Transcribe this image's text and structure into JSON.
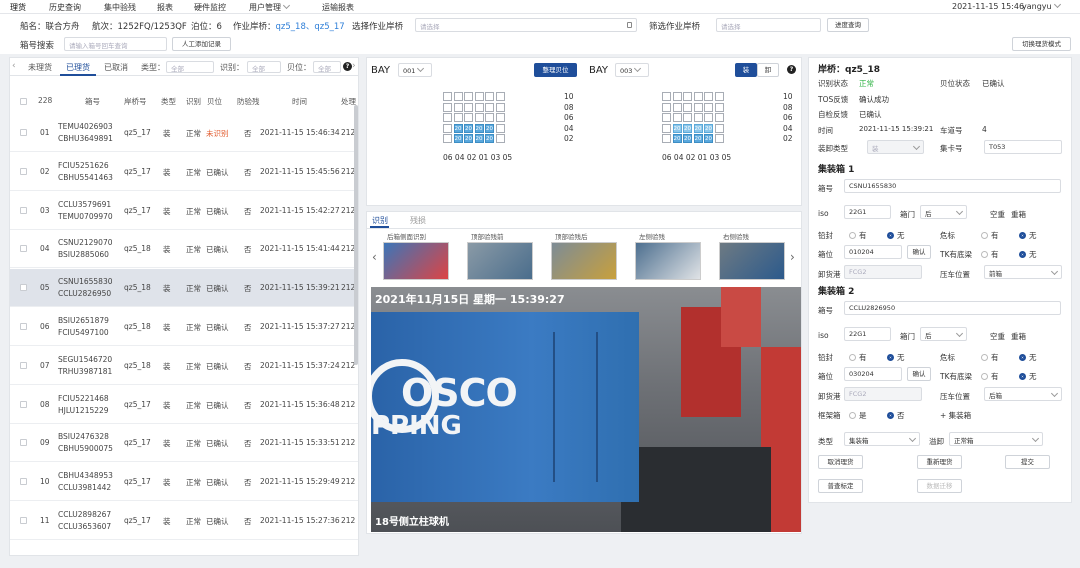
{
  "nav": {
    "items": [
      "理货",
      "历史查询",
      "集中验残",
      "报表",
      "硬件监控",
      "用户管理",
      "运输报表"
    ],
    "datetime": "2021-11-15 15:46",
    "user": "yangyu"
  },
  "info": {
    "ship_label": "船名：",
    "ship": "联合方舟",
    "voyage_label": "航次：",
    "voyage": "1252FQ/1253QF",
    "berth_label": "泊位：",
    "berth": "6",
    "bridge_label": "作业岸桥：",
    "bridge1": "qz5_18、",
    "bridge2": "qz5_17",
    "select_bridge_label": "选择作业岸桥",
    "select_placeholder": "请选择",
    "filter_label": "筛选作业岸桥",
    "filter_placeholder": "请选择",
    "progress_btn": "进度查询",
    "box_search_label": "箱号搜索",
    "box_search_placeholder": "请输入箱号回车查询",
    "manual_add": "人工添加记录",
    "switch_mode": "切换理货模式"
  },
  "left": {
    "tabs": [
      "未理货",
      "已理货",
      "已取消"
    ],
    "type_label": "类型：",
    "type_val": "全部",
    "ident_label": "识别：",
    "ident_val": "全部",
    "slot_label": "贝位：",
    "slot_val": "全部",
    "head": {
      "count": "228",
      "box": "箱号",
      "bridge": "岸桥号",
      "kind": "类型",
      "ident": "识别",
      "slot": "贝位",
      "inspect": "防验残",
      "time": "时间",
      "proc": "处理"
    },
    "rows": [
      {
        "no": "01",
        "b1": "TEMU4026903",
        "b2": "CBHU3649891",
        "bridge": "qz5_17",
        "kind": "装",
        "ident": "正常",
        "slot": "未识别",
        "inspect": "否",
        "time": "2021-11-15 15:46:34",
        "proc": "212"
      },
      {
        "no": "02",
        "b1": "FCIU5251626",
        "b2": "CBHU5541463",
        "bridge": "qz5_17",
        "kind": "装",
        "ident": "正常",
        "slot": "已确认",
        "inspect": "否",
        "time": "2021-11-15 15:45:56",
        "proc": "212"
      },
      {
        "no": "03",
        "b1": "CCLU3579691",
        "b2": "TEMU0709970",
        "bridge": "qz5_17",
        "kind": "装",
        "ident": "正常",
        "slot": "已确认",
        "inspect": "否",
        "time": "2021-11-15 15:42:27",
        "proc": "212"
      },
      {
        "no": "04",
        "b1": "CSNU2129070",
        "b2": "BSIU2885060",
        "bridge": "qz5_18",
        "kind": "装",
        "ident": "正常",
        "slot": "已确认",
        "inspect": "否",
        "time": "2021-11-15 15:41:44",
        "proc": "212"
      },
      {
        "no": "05",
        "b1": "CSNU1655830",
        "b2": "CCLU2826950",
        "bridge": "qz5_18",
        "kind": "装",
        "ident": "正常",
        "slot": "已确认",
        "inspect": "否",
        "time": "2021-11-15 15:39:21",
        "proc": "212"
      },
      {
        "no": "06",
        "b1": "BSIU2651879",
        "b2": "FCIU5497100",
        "bridge": "qz5_18",
        "kind": "装",
        "ident": "正常",
        "slot": "已确认",
        "inspect": "否",
        "time": "2021-11-15 15:37:27",
        "proc": "212"
      },
      {
        "no": "07",
        "b1": "SEGU1546720",
        "b2": "TRHU3987181",
        "bridge": "qz5_18",
        "kind": "装",
        "ident": "正常",
        "slot": "已确认",
        "inspect": "否",
        "time": "2021-11-15 15:37:24",
        "proc": "212"
      },
      {
        "no": "08",
        "b1": "FCIU5221468",
        "b2": "HJLU1215229",
        "bridge": "qz5_17",
        "kind": "装",
        "ident": "正常",
        "slot": "已确认",
        "inspect": "否",
        "time": "2021-11-15 15:36:48",
        "proc": "212"
      },
      {
        "no": "09",
        "b1": "BSIU2476328",
        "b2": "CBHU5900075",
        "bridge": "qz5_17",
        "kind": "装",
        "ident": "正常",
        "slot": "已确认",
        "inspect": "否",
        "time": "2021-11-15 15:33:51",
        "proc": "212"
      },
      {
        "no": "10",
        "b1": "CBHU4348953",
        "b2": "CCLU3981442",
        "bridge": "qz5_17",
        "kind": "装",
        "ident": "正常",
        "slot": "已确认",
        "inspect": "否",
        "time": "2021-11-15 15:29:49",
        "proc": "212"
      },
      {
        "no": "11",
        "b1": "CCLU2898267",
        "b2": "CCLU3653607",
        "bridge": "qz5_17",
        "kind": "装",
        "ident": "正常",
        "slot": "已确认",
        "inspect": "否",
        "time": "2021-11-15 15:27:36",
        "proc": "212"
      }
    ]
  },
  "bay": {
    "bay_label": "BAY",
    "bay1": "001",
    "sort_btn": "整理贝位",
    "bay2": "003",
    "mode_on": "装",
    "mode_off": "卸",
    "help": "?",
    "rows": [
      "10",
      "08",
      "06",
      "04",
      "02"
    ],
    "cols": "06 04 02 01 03 05",
    "cell_val": "20"
  },
  "photos": {
    "tabs": [
      "识别",
      "残损"
    ],
    "thumbs": [
      "后箱侧面识别",
      "顶部验残前",
      "顶部验残后",
      "左侧验残",
      "右侧验残"
    ],
    "timestamp": "2021年11月15日  星期一  15:39:27",
    "crane_label": "18号侧立柱球机",
    "logo": "OSCO",
    "logo2": "PPING"
  },
  "right": {
    "bridge_title": "岸桥：qz5_18",
    "ident_status_label": "识别状态",
    "ident_status": "正常",
    "slot_status_label": "贝位状态",
    "slot_status": "已确认",
    "tos_label": "TOS反馈",
    "tos": "确认成功",
    "self_label": "自检反馈",
    "self": "已确认",
    "time_label": "时间",
    "time": "2021-11-15 15:39:21",
    "lane_label": "车道号",
    "lane": "4",
    "load_type_label": "装卸类型",
    "load_type": "装",
    "card_label": "集卡号",
    "card": "T053",
    "c1": {
      "title": "集装箱 1",
      "box_label": "箱号",
      "box": "CSNU1655830",
      "iso_label": "iso",
      "iso": "22G1",
      "door_label": "箱门",
      "door": "后",
      "empty_label": "空重",
      "empty": "重箱",
      "seal_label": "铅封",
      "yes": "有",
      "no": "无",
      "danger_label": "危标",
      "slot_label": "箱位",
      "slot": "010204",
      "confirm": "确认",
      "tk_label": "TK有底梁",
      "unload_label": "卸货港",
      "unload": "FCG2",
      "press_label": "压车位置",
      "press": "前箱"
    },
    "c2": {
      "title": "集装箱 2",
      "box_label": "箱号",
      "box": "CCLU2826950",
      "iso_label": "iso",
      "iso": "22G1",
      "door_label": "箱门",
      "door": "后",
      "empty_label": "空重",
      "empty": "重箱",
      "seal_label": "铅封",
      "yes": "有",
      "no": "无",
      "danger_label": "危标",
      "slot_label": "箱位",
      "slot": "030204",
      "confirm": "确认",
      "tk_label": "TK有底梁",
      "unload_label": "卸货港",
      "unload": "FCG2",
      "press_label": "压车位置",
      "press": "后箱"
    },
    "frame_label": "框架箱",
    "frame_yes": "是",
    "frame_no": "否",
    "add_box": "+ 集装箱",
    "kind_label": "类型",
    "kind": "集装箱",
    "overflow_label": "溢卸",
    "overflow": "正常箱",
    "btn_cancel": "取消理货",
    "btn_retally": "重新理货",
    "btn_submit": "提交",
    "btn_mark": "普查标定",
    "btn_migrate": "数据迁移"
  },
  "colors": {
    "accent": "#1f4e9a",
    "alert": "#e15a2c",
    "status_ok": "#2fb344",
    "container": "#2f6fb0"
  }
}
